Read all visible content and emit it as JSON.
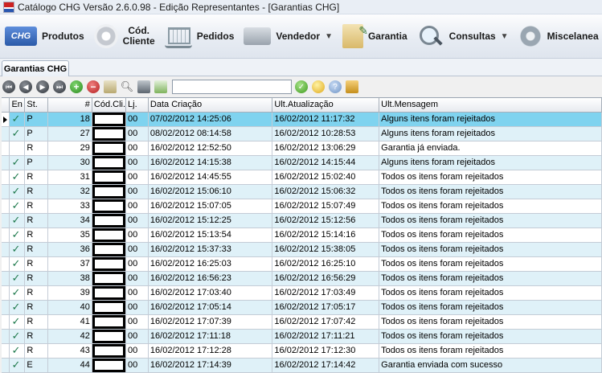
{
  "window": {
    "title": "Catálogo CHG Versão 2.6.0.98 - Edição Representantes - [Garantias CHG]",
    "icon": "chg-app-icon"
  },
  "toolbar": {
    "items": [
      {
        "label": "Produtos",
        "icon": "chg-logo-icon",
        "dropdown": false
      },
      {
        "label_line1": "Cód.",
        "label_line2": "Cliente",
        "icon": "cd-icon",
        "dropdown": false
      },
      {
        "label": "Pedidos",
        "icon": "cart-icon",
        "dropdown": false
      },
      {
        "label": "Vendedor",
        "icon": "cash-register-icon",
        "dropdown": true
      },
      {
        "label": "Garantia",
        "icon": "clipboard-icon",
        "dropdown": false
      },
      {
        "label": "Consultas",
        "icon": "magnifier-icon",
        "dropdown": true
      },
      {
        "label": "Miscelanea",
        "icon": "gear-icon",
        "dropdown": true
      }
    ]
  },
  "tabs": [
    {
      "label": "Garantias CHG",
      "active": true
    }
  ],
  "navigator": {
    "search_value": "",
    "icons": [
      "first-icon",
      "prev-icon",
      "next-icon",
      "last-icon",
      "add-icon",
      "delete-icon",
      "document-icon",
      "find-icon",
      "print-icon",
      "image-icon",
      "confirm-icon",
      "lightbulb-icon",
      "help-icon",
      "exit-icon"
    ]
  },
  "grid": {
    "columns": [
      "En",
      "St.",
      "#",
      "Cód.Cli.",
      "Lj.",
      "Data Criação",
      "Ult.Atualização",
      "Ult.Mensagem"
    ],
    "rows": [
      {
        "en": "✓",
        "st": "P",
        "num": "18",
        "codcli": "",
        "lj": "00",
        "criacao": "07/02/2012 14:25:06",
        "atualizacao": "16/02/2012 11:17:32",
        "mensagem": "Alguns itens foram rejeitados",
        "selected": true
      },
      {
        "en": "✓",
        "st": "P",
        "num": "27",
        "codcli": "",
        "lj": "00",
        "criacao": "08/02/2012 08:14:58",
        "atualizacao": "16/02/2012 10:28:53",
        "mensagem": "Alguns itens foram rejeitados"
      },
      {
        "en": "",
        "st": "R",
        "num": "29",
        "codcli": "",
        "lj": "00",
        "criacao": "16/02/2012 12:52:50",
        "atualizacao": "16/02/2012 13:06:29",
        "mensagem": "Garantia já enviada."
      },
      {
        "en": "✓",
        "st": "P",
        "num": "30",
        "codcli": "",
        "lj": "00",
        "criacao": "16/02/2012 14:15:38",
        "atualizacao": "16/02/2012 14:15:44",
        "mensagem": "Alguns itens foram rejeitados"
      },
      {
        "en": "✓",
        "st": "R",
        "num": "31",
        "codcli": "",
        "lj": "00",
        "criacao": "16/02/2012 14:45:55",
        "atualizacao": "16/02/2012 15:02:40",
        "mensagem": "Todos os itens foram rejeitados"
      },
      {
        "en": "✓",
        "st": "R",
        "num": "32",
        "codcli": "",
        "lj": "00",
        "criacao": "16/02/2012 15:06:10",
        "atualizacao": "16/02/2012 15:06:32",
        "mensagem": "Todos os itens foram rejeitados"
      },
      {
        "en": "✓",
        "st": "R",
        "num": "33",
        "codcli": "",
        "lj": "00",
        "criacao": "16/02/2012 15:07:05",
        "atualizacao": "16/02/2012 15:07:49",
        "mensagem": "Todos os itens foram rejeitados"
      },
      {
        "en": "✓",
        "st": "R",
        "num": "34",
        "codcli": "",
        "lj": "00",
        "criacao": "16/02/2012 15:12:25",
        "atualizacao": "16/02/2012 15:12:56",
        "mensagem": "Todos os itens foram rejeitados"
      },
      {
        "en": "✓",
        "st": "R",
        "num": "35",
        "codcli": "",
        "lj": "00",
        "criacao": "16/02/2012 15:13:54",
        "atualizacao": "16/02/2012 15:14:16",
        "mensagem": "Todos os itens foram rejeitados"
      },
      {
        "en": "✓",
        "st": "R",
        "num": "36",
        "codcli": "",
        "lj": "00",
        "criacao": "16/02/2012 15:37:33",
        "atualizacao": "16/02/2012 15:38:05",
        "mensagem": "Todos os itens foram rejeitados"
      },
      {
        "en": "✓",
        "st": "R",
        "num": "37",
        "codcli": "",
        "lj": "00",
        "criacao": "16/02/2012 16:25:03",
        "atualizacao": "16/02/2012 16:25:10",
        "mensagem": "Todos os itens foram rejeitados"
      },
      {
        "en": "✓",
        "st": "R",
        "num": "38",
        "codcli": "",
        "lj": "00",
        "criacao": "16/02/2012 16:56:23",
        "atualizacao": "16/02/2012 16:56:29",
        "mensagem": "Todos os itens foram rejeitados"
      },
      {
        "en": "✓",
        "st": "R",
        "num": "39",
        "codcli": "",
        "lj": "00",
        "criacao": "16/02/2012 17:03:40",
        "atualizacao": "16/02/2012 17:03:49",
        "mensagem": "Todos os itens foram rejeitados"
      },
      {
        "en": "✓",
        "st": "R",
        "num": "40",
        "codcli": "",
        "lj": "00",
        "criacao": "16/02/2012 17:05:14",
        "atualizacao": "16/02/2012 17:05:17",
        "mensagem": "Todos os itens foram rejeitados"
      },
      {
        "en": "✓",
        "st": "R",
        "num": "41",
        "codcli": "",
        "lj": "00",
        "criacao": "16/02/2012 17:07:39",
        "atualizacao": "16/02/2012 17:07:42",
        "mensagem": "Todos os itens foram rejeitados"
      },
      {
        "en": "✓",
        "st": "R",
        "num": "42",
        "codcli": "",
        "lj": "00",
        "criacao": "16/02/2012 17:11:18",
        "atualizacao": "16/02/2012 17:11:21",
        "mensagem": "Todos os itens foram rejeitados"
      },
      {
        "en": "✓",
        "st": "R",
        "num": "43",
        "codcli": "",
        "lj": "00",
        "criacao": "16/02/2012 17:12:28",
        "atualizacao": "16/02/2012 17:12:30",
        "mensagem": "Todos os itens foram rejeitados"
      },
      {
        "en": "✓",
        "st": "E",
        "num": "44",
        "codcli": "",
        "lj": "00",
        "criacao": "16/02/2012 17:14:39",
        "atualizacao": "16/02/2012 17:14:42",
        "mensagem": "Garantia enviada com sucesso"
      }
    ]
  },
  "colors": {
    "selected_row": "#7fd3ef",
    "alt_row": "#dff1f8",
    "check": "#1f7a4d"
  }
}
